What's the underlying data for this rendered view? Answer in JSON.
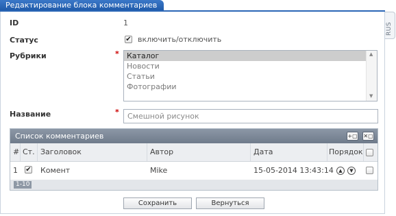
{
  "window": {
    "title": "Редактирование блока комментариев",
    "lang_tab": "RUS"
  },
  "form": {
    "id": {
      "label": "ID",
      "value": "1"
    },
    "status": {
      "label": "Статус",
      "checkbox_label": "включить/отключить",
      "checked": true
    },
    "categories": {
      "label": "Рубрики",
      "required_mark": "*",
      "options": [
        "Каталог",
        "Новости",
        "Статьи",
        "Фотографии"
      ],
      "selected": "Каталог"
    },
    "name": {
      "label": "Название",
      "required_mark": "*",
      "placeholder": "Смешной рисунок"
    }
  },
  "comments_grid": {
    "title": "Список комментариев",
    "toolbar": {
      "add_icon": "add-record-icon",
      "delete_icon": "delete-record-icon"
    },
    "columns": {
      "num": "#",
      "status": "Ст.",
      "heading": "Заголовок",
      "author": "Автор",
      "date": "Дата",
      "order": "Порядок"
    },
    "rows": [
      {
        "num": "1",
        "checked": true,
        "heading": "Комент",
        "author": "Mike",
        "date": "15-05-2014 13:43:14"
      }
    ],
    "pager": "1-10"
  },
  "buttons": {
    "save": "Сохранить",
    "back": "Вернуться"
  },
  "colors": {
    "tab_blue": "#2a66b6",
    "grid_header": "#7a8696",
    "required": "#cc0000"
  }
}
